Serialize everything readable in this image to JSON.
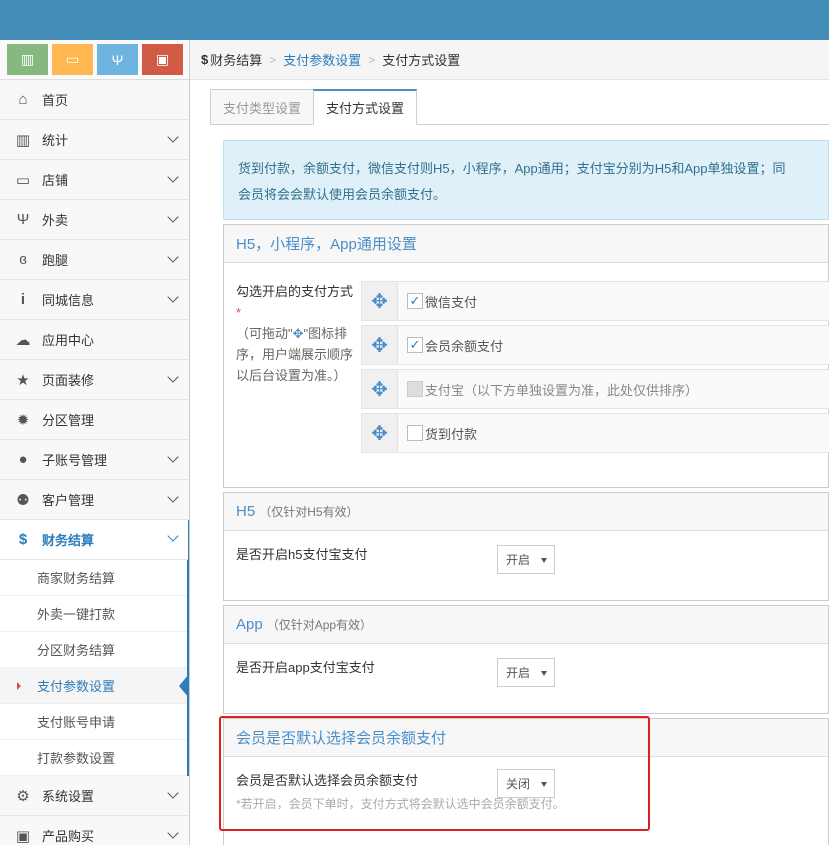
{
  "colors": {
    "topbar": "#438eb9",
    "accent": "#2b7dbc",
    "highlight": "#e02020"
  },
  "shortcuts": [
    {
      "icon": "bar-chart-icon",
      "color": "#87b87f",
      "glyph": "▥"
    },
    {
      "icon": "monitor-icon",
      "color": "#ffb752",
      "glyph": "▭"
    },
    {
      "icon": "utensils-icon",
      "color": "#6fb3e0",
      "glyph": "Ψ"
    },
    {
      "icon": "briefcase-icon",
      "color": "#d15b47",
      "glyph": "▣"
    }
  ],
  "sidebar": {
    "items": [
      {
        "label": "首页",
        "icon": "home-icon"
      },
      {
        "label": "统计",
        "icon": "bar-chart-icon"
      },
      {
        "label": "店铺",
        "icon": "monitor-icon"
      },
      {
        "label": "外卖",
        "icon": "utensils-icon"
      },
      {
        "label": "跑腿",
        "icon": "bicycle-icon"
      },
      {
        "label": "同城信息",
        "icon": "info-icon"
      },
      {
        "label": "应用中心",
        "icon": "cloud-icon"
      },
      {
        "label": "页面装修",
        "icon": "star-icon"
      },
      {
        "label": "分区管理",
        "icon": "cog-icon"
      },
      {
        "label": "子账号管理",
        "icon": "user-icon"
      },
      {
        "label": "客户管理",
        "icon": "users-icon"
      },
      {
        "label": "财务结算",
        "icon": "dollar-icon"
      },
      {
        "label": "系统设置",
        "icon": "gear-icon"
      },
      {
        "label": "产品购买",
        "icon": "shopping-bag-icon"
      }
    ],
    "finance_sub": [
      "商家财务结算",
      "外卖一键打款",
      "分区财务结算",
      "支付参数设置",
      "支付账号申请",
      "打款参数设置"
    ]
  },
  "breadcrumb": {
    "home": "财务结算",
    "level2": "支付参数设置",
    "level3": "支付方式设置"
  },
  "tabs": [
    "支付类型设置",
    "支付方式设置"
  ],
  "notice": {
    "line1": "货到付款，余额支付，微信支付则H5，小程序，App通用；支付宝分别为H5和App单独设置；同",
    "line2": "会员将会会默认使用会员余额支付。"
  },
  "general": {
    "title": "H5，小程序，App通用设置",
    "sort_label": "勾选开启的支付方式",
    "required": "*",
    "hint_pre": "（可拖动\"",
    "hint_post": "\"图标排序，用户端展示顺序以后台设置为准。）",
    "methods": [
      {
        "label": "微信支付",
        "checked": true,
        "disabled": false
      },
      {
        "label": "会员余额支付",
        "checked": true,
        "disabled": false
      },
      {
        "label": "支付宝（以下方单独设置为准，此处仅供排序）",
        "checked": false,
        "disabled": true
      },
      {
        "label": "货到付款",
        "checked": false,
        "disabled": false
      }
    ]
  },
  "h5": {
    "title": "H5",
    "subtitle": "（仅针对H5有效）",
    "label": "是否开启h5支付宝支付",
    "value": "开启"
  },
  "app": {
    "title": "App",
    "subtitle": "（仅针对App有效）",
    "label": "是否开启app支付宝支付",
    "value": "开启"
  },
  "member": {
    "title": "会员是否默认选择会员余额支付",
    "label": "会员是否默认选择会员余额支付",
    "value": "关闭",
    "help": "*若开启，会员下单时，支付方式将会默认选中会员余额支付。"
  }
}
